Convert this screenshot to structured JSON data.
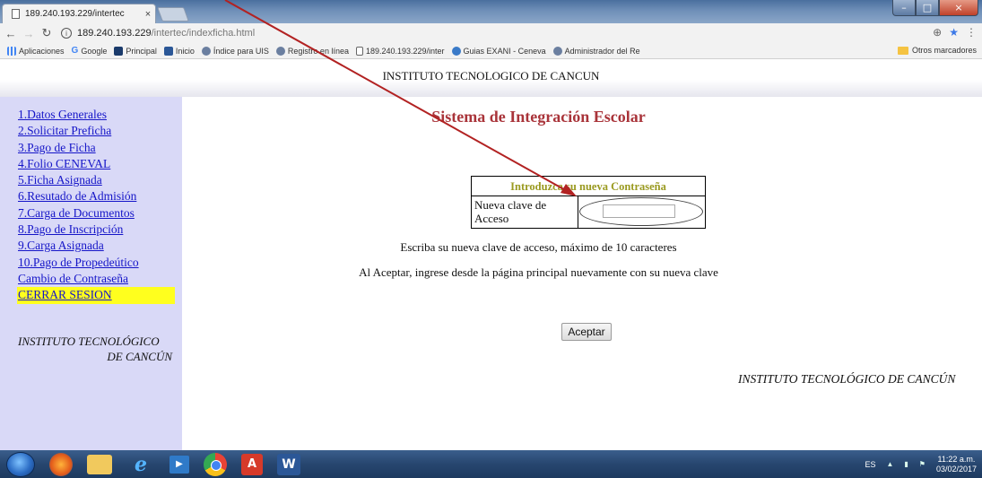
{
  "browser": {
    "tab_title": "189.240.193.229/intertec",
    "tab_close": "×",
    "url_host": "189.240.193.229",
    "url_path": "/intertec/indexficha.html",
    "bookmarks": [
      {
        "label": "Aplicaciones"
      },
      {
        "label": "Google"
      },
      {
        "label": "Principal"
      },
      {
        "label": "Inicio"
      },
      {
        "label": "Índice para UIS"
      },
      {
        "label": "Registro en línea"
      },
      {
        "label": "189.240.193.229/inter"
      },
      {
        "label": "Guias EXANI - Ceneva"
      },
      {
        "label": "Administrador del Re"
      }
    ],
    "other_bookmarks": "Otros marcadores"
  },
  "page": {
    "header": "INSTITUTO TECNOLOGICO DE CANCUN",
    "title": "Sistema de Integración Escolar",
    "sidebar_links": [
      "1.Datos Generales",
      "2.Solicitar Preficha",
      "3.Pago de Ficha",
      "4.Folio CENEVAL",
      "5.Ficha Asignada",
      "6.Resutado de Admisión",
      "7.Carga de Documentos",
      "8.Pago de Inscripción",
      "9.Carga Asignada",
      "10.Pago de Propedeútico",
      "Cambio de Contraseña",
      "CERRAR SESION"
    ],
    "sidebar_institute_line1": "INSTITUTO TECNOLÓGICO",
    "sidebar_institute_line2": "DE CANCÚN",
    "form_heading": "Introduzca su nueva Contraseña",
    "form_label_line1": "Nueva clave de",
    "form_label_line2": "Acceso",
    "password_value": "",
    "instruction_1": "Escriba su nueva clave de acceso, máximo de 10 caracteres",
    "instruction_2": "Al Aceptar, ingrese desde la página principal nuevamente con su nueva clave",
    "accept_button": "Aceptar",
    "footer_institute": "INSTITUTO TECNOLÓGICO DE CANCÚN"
  },
  "taskbar": {
    "language": "ES",
    "time": "11:22 a.m.",
    "date": "03/02/2017"
  },
  "colors": {
    "sidebar_bg": "#d9d9f7",
    "link": "#1515c8",
    "logout_highlight": "#ffff1e",
    "title": "#a9343a",
    "form_heading": "#9a9a20",
    "annotation_arrow": "#b22222"
  }
}
